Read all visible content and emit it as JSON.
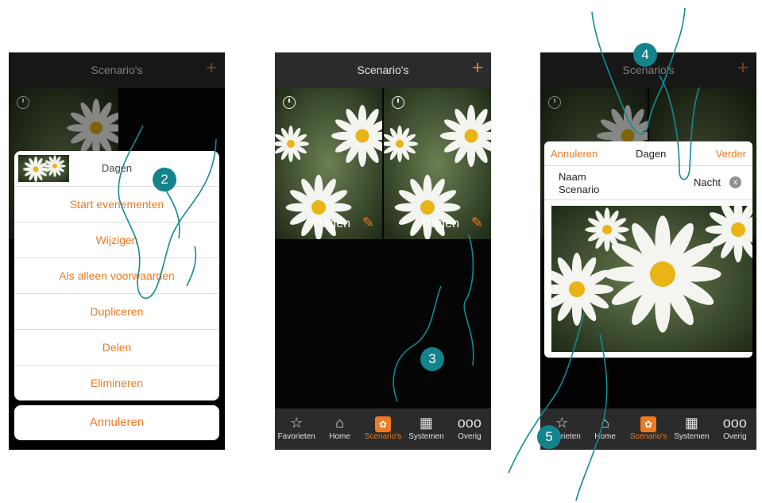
{
  "panels": [
    {
      "title": "Scenario's",
      "plus": "+",
      "sheet": {
        "header": "Dagen",
        "options": [
          "Start evenementen",
          "Wijzigen",
          "Als alleen voorwaarden",
          "Dupliceren",
          "Delen",
          "Elimineren"
        ],
        "cancel": "Annuleren"
      }
    },
    {
      "title": "Scenario's",
      "plus": "+",
      "tiles": [
        {
          "label": "Dagen",
          "pencil": "✎"
        },
        {
          "label": "Dagen",
          "pencil": "✎"
        }
      ]
    },
    {
      "title": "Scenario's",
      "plus": "+",
      "edit": {
        "cancel": "Annuleren",
        "center": "Dagen",
        "next": "Verder",
        "name_label_1": "Naam",
        "name_label_2": "Scenario",
        "name_value": "Nacht",
        "clear": "x"
      }
    }
  ],
  "tabs": [
    {
      "label": "Favorieten",
      "icon": "star-icon",
      "glyph": "☆"
    },
    {
      "label": "Home",
      "icon": "house-icon",
      "glyph": "⌂"
    },
    {
      "label": "Scenario's",
      "icon": "scenario-icon",
      "glyph": "✿"
    },
    {
      "label": "Systemen",
      "icon": "grid-icon",
      "glyph": "▦"
    },
    {
      "label": "Overig",
      "icon": "more-icon",
      "glyph": "ooo"
    }
  ],
  "badges": [
    "2",
    "3",
    "4",
    "5"
  ],
  "colors": {
    "accent": "#ef7a22",
    "badge": "#13838c",
    "bar": "#2b2b2b"
  }
}
